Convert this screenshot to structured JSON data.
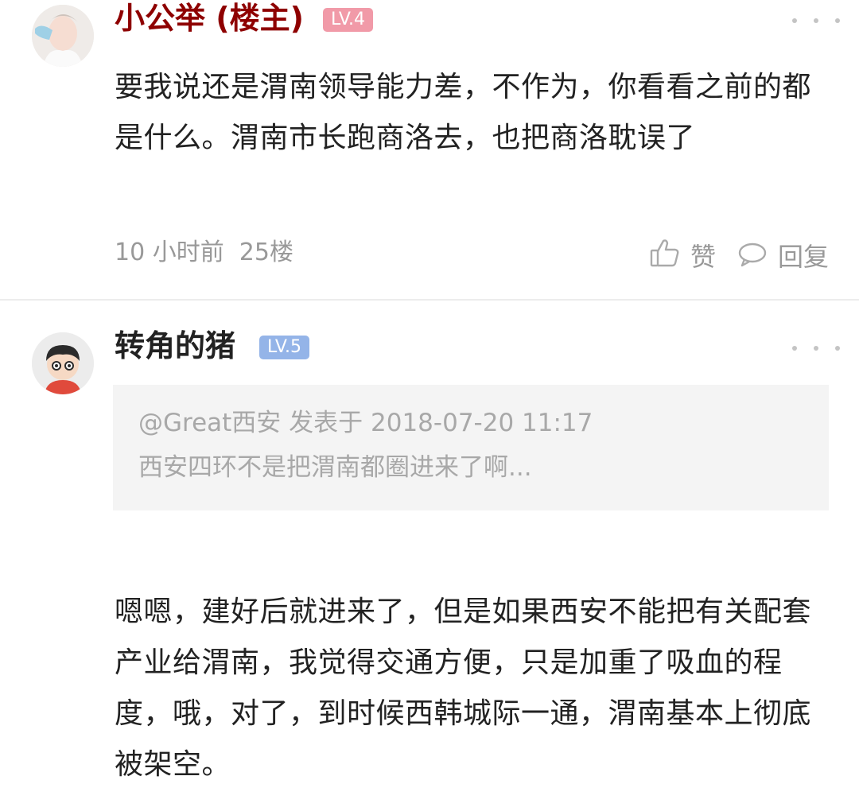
{
  "posts": [
    {
      "author": "小公举 (楼主)",
      "level": "LV.4",
      "level_color": "#f19aa8",
      "name_color": "#8e0000",
      "content": "要我说还是渭南领导能力差，不作为，你看看之前的都是什么。渭南市长跑商洛去，也把商洛耽误了",
      "time": "10 小时前",
      "floor": "25楼",
      "like_label": "赞",
      "reply_label": "回复",
      "icons": {
        "like": "thumbs-up-icon",
        "reply": "chat-bubble-icon",
        "more": "more-dots-icon"
      }
    },
    {
      "author": "转角的猪",
      "level": "LV.5",
      "level_color": "#94b4e8",
      "name_color": "#222222",
      "quote": {
        "header": "@Great西安 发表于 2018-07-20 11:17",
        "text": "西安四环不是把渭南都圈进来了啊..."
      },
      "content": "嗯嗯，建好后就进来了，但是如果西安不能把有关配套产业给渭南，我觉得交通方便，只是加重了吸血的程度，哦，对了，到时候西韩城际一通，渭南基本上彻底被架空。",
      "icons": {
        "more": "more-dots-icon"
      }
    }
  ]
}
